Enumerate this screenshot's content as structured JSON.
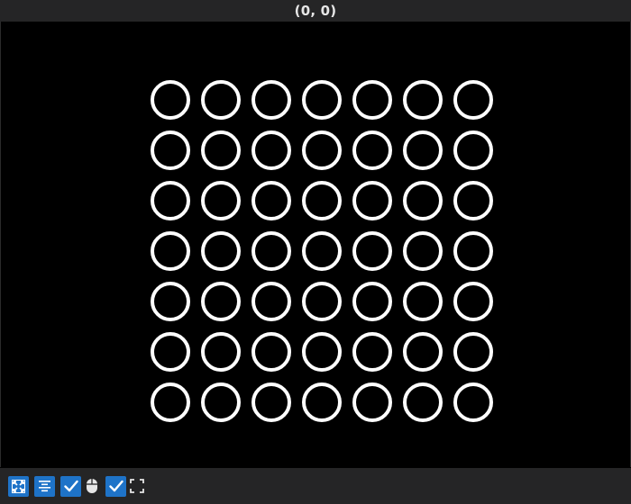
{
  "window": {
    "title": "(0, 0)"
  },
  "scene": {
    "rows": 7,
    "cols": 7,
    "shape": "circle-outline",
    "stroke_color": "#ffffff",
    "background_color": "#000000"
  },
  "toolbar": {
    "items": [
      {
        "name": "fit-view-button",
        "icon": "fit-to-view-icon",
        "active": true
      },
      {
        "name": "center-align-button",
        "icon": "align-center-icon",
        "active": true
      },
      {
        "name": "mouse-interaction-toggle",
        "icon": "mouse-icon",
        "checked": true
      },
      {
        "name": "fullscreen-toggle",
        "icon": "fullscreen-icon",
        "checked": true
      }
    ],
    "accent_color": "#1e73c8"
  }
}
